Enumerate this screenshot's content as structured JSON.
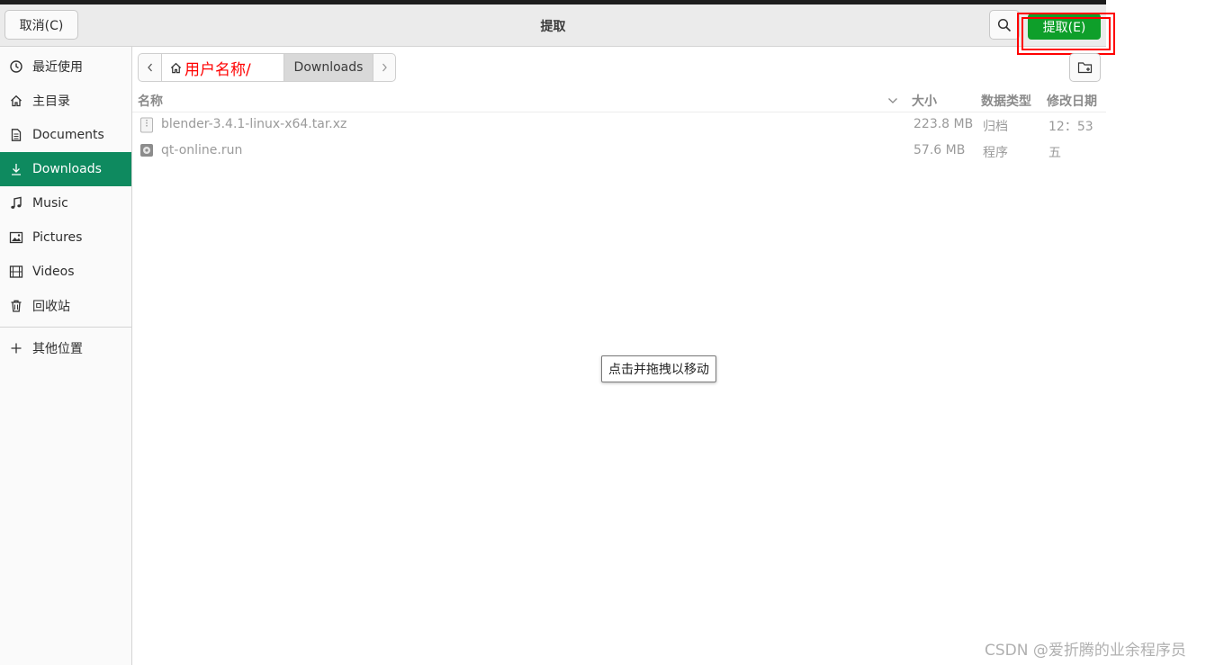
{
  "header": {
    "cancel_label": "取消(C)",
    "title": "提取",
    "extract_label": "提取(E)",
    "extract_color": "#0e9f2a",
    "highlight_color": "#ff0000"
  },
  "sidebar": {
    "items": [
      {
        "label": "最近使用",
        "icon": "clock-icon"
      },
      {
        "label": "主目录",
        "icon": "home-icon"
      },
      {
        "label": "Documents",
        "icon": "document-icon"
      },
      {
        "label": "Downloads",
        "icon": "download-icon",
        "active": true
      },
      {
        "label": "Music",
        "icon": "music-note-icon"
      },
      {
        "label": "Pictures",
        "icon": "picture-icon"
      },
      {
        "label": "Videos",
        "icon": "film-icon"
      },
      {
        "label": "回收站",
        "icon": "trash-icon"
      }
    ],
    "other_locations": {
      "label": "其他位置",
      "icon": "plus-icon"
    },
    "active_color": "#0e8a5f"
  },
  "pathbar": {
    "home_annotation": "用户名称/",
    "current": "Downloads"
  },
  "columns": {
    "name": "名称",
    "size": "大小",
    "type": "数据类型",
    "modified": "修改日期"
  },
  "files": [
    {
      "name": "blender-3.4.1-linux-x64.tar.xz",
      "size": "223.8 MB",
      "type": "归档",
      "modified": "12：53",
      "icon": "archive-icon"
    },
    {
      "name": "qt-online.run",
      "size": "57.6 MB",
      "type": "程序",
      "modified": "五",
      "icon": "executable-icon"
    }
  ],
  "tooltip": "点击并拖拽以移动",
  "watermark": "CSDN @爱折腾的业余程序员"
}
